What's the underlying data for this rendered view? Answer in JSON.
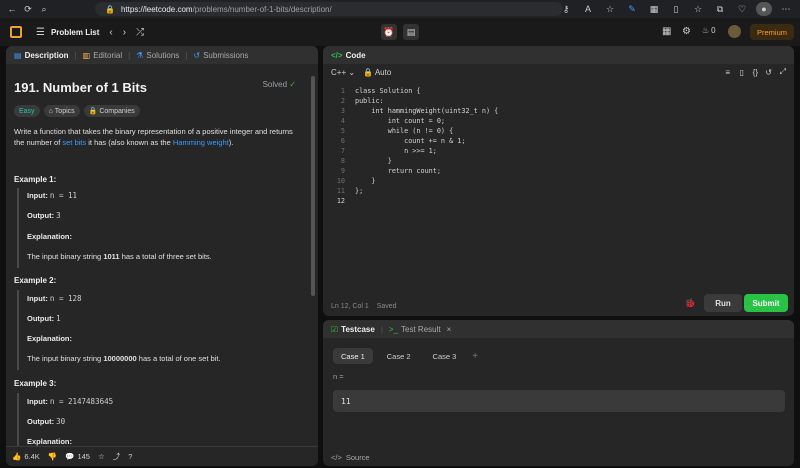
{
  "browser": {
    "url_domain": "https://leetcode.com",
    "url_path": "/problems/number-of-1-bits/description/"
  },
  "navbar": {
    "problem_list": "Problem List",
    "streak_count": "0",
    "premium": "Premium"
  },
  "description": {
    "tabs": [
      "Description",
      "Editorial",
      "Solutions",
      "Submissions"
    ],
    "title": "191. Number of 1 Bits",
    "status": "Solved",
    "chips": {
      "difficulty": "Easy",
      "topics": "Topics",
      "companies": "Companies"
    },
    "statement_prefix": "Write a function that takes the binary representation of a positive integer and returns the number of",
    "statement_link1": "set bits",
    "statement_mid": "it has (also known as the",
    "statement_link2": "Hamming weight",
    "statement_suffix": ").",
    "examples": [
      {
        "header": "Example 1:",
        "input_label": "Input:",
        "input_value": "n = 11",
        "output_label": "Output:",
        "output_value": "3",
        "explanation_label": "Explanation:",
        "explanation_pre": "The input binary string",
        "explanation_bold": "1011",
        "explanation_post": "has a total of three set bits."
      },
      {
        "header": "Example 2:",
        "input_label": "Input:",
        "input_value": "n = 128",
        "output_label": "Output:",
        "output_value": "1",
        "explanation_label": "Explanation:",
        "explanation_pre": "The input binary string",
        "explanation_bold": "10000000",
        "explanation_post": "has a total of one set bit."
      },
      {
        "header": "Example 3:",
        "input_label": "Input:",
        "input_value": "n = 2147483645",
        "output_label": "Output:",
        "output_value": "30",
        "explanation_label": "Explanation:"
      }
    ],
    "bottom": {
      "likes": "6.4K",
      "comments": "145"
    }
  },
  "code": {
    "tab": "Code",
    "language": "C++",
    "mode": "Auto",
    "lines": [
      "class Solution {",
      "public:",
      "    int hammingWeight(uint32_t n) {",
      "        int count = 0;",
      "        while (n != 0) {",
      "            count += n & 1;",
      "            n >>= 1;",
      "        }",
      "        return count;",
      "    }",
      "};",
      ""
    ],
    "cursor": "Ln 12, Col 1",
    "saved": "Saved",
    "run": "Run",
    "submit": "Submit"
  },
  "testcase": {
    "tab_testcase": "Testcase",
    "tab_result": "Test Result",
    "cases": [
      "Case 1",
      "Case 2",
      "Case 3"
    ],
    "var_label": "n =",
    "value": "11",
    "source": "Source"
  },
  "colors": {
    "accent_green": "#28c244",
    "link_blue": "#3b9bff",
    "easy": "#1ec6b8"
  }
}
